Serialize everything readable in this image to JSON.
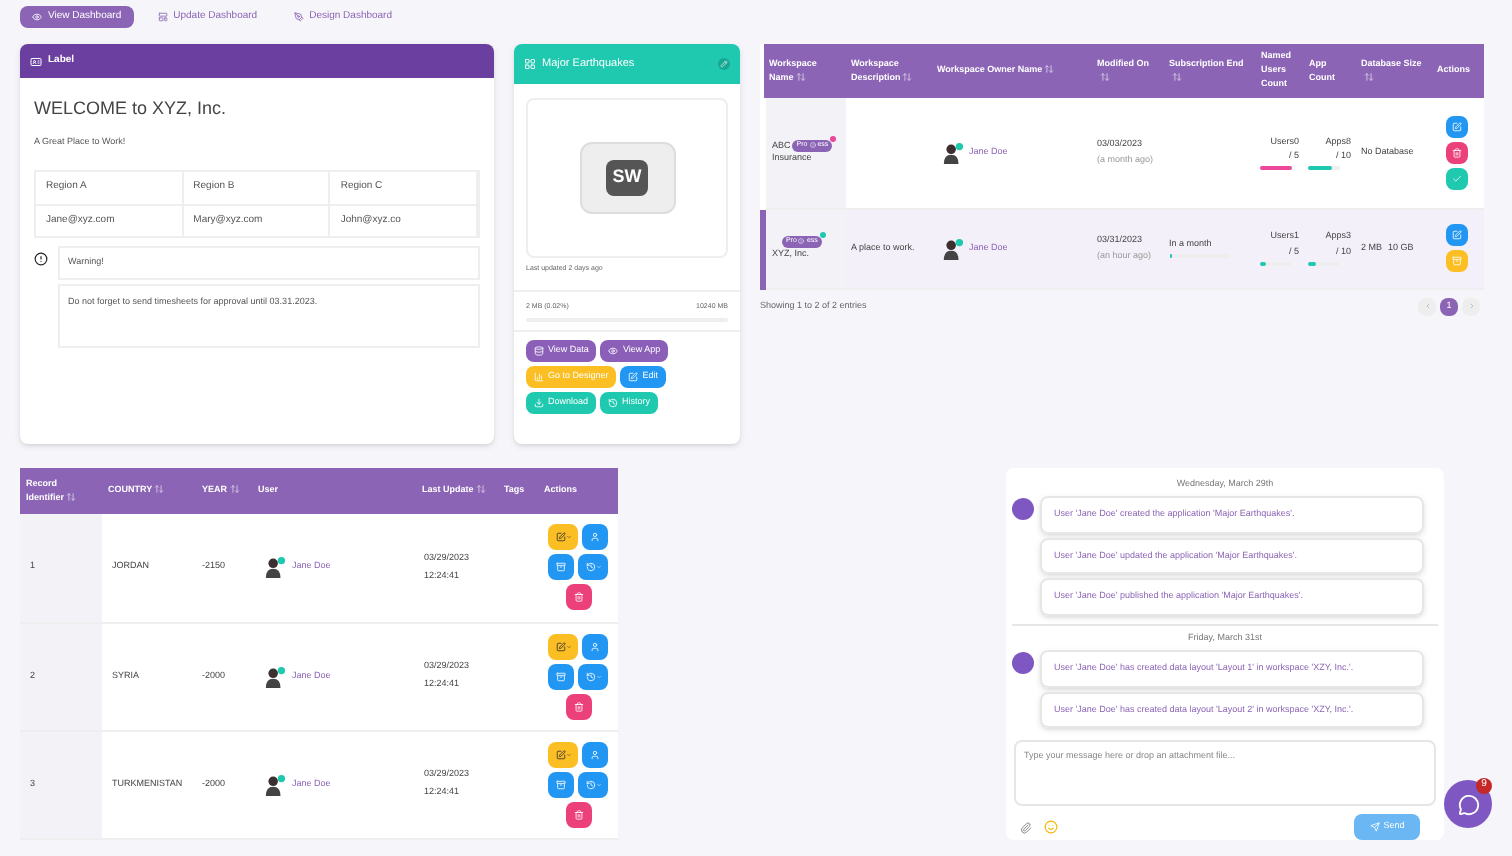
{
  "view_tabs": [
    {
      "label": "View Dashboard",
      "selected": true
    },
    {
      "label": "Update Dashboard",
      "selected": false
    },
    {
      "label": "Design Dashboard",
      "selected": false
    }
  ],
  "label_card": {
    "title": "Label",
    "heading": "WELCOME to XYZ, Inc.",
    "subheading": "A Great Place to Work!",
    "region_headers": [
      "Region A",
      "Region B",
      "Region C"
    ],
    "region_emails": [
      "Jane@xyz.com",
      "Mary@xyz.com",
      "John@xyz.co"
    ],
    "warning_title": "Warning!",
    "warning_message": "Do not forget to send timesheets for approval until 03.31.2023."
  },
  "app_card": {
    "title": "Major Earthquakes",
    "logo_text": "SW",
    "updated": "Last updated 2 days ago",
    "storage": {
      "used": "2 MB (0.02%)",
      "total": "10240 MB",
      "level": 0.0002
    },
    "buttons": [
      {
        "label": "View Data",
        "kind": "data",
        "color": "#8b5fb8"
      },
      {
        "label": "View App",
        "kind": "app",
        "color": "#8b5fb8"
      },
      {
        "label": "Go to Designer",
        "kind": "designer",
        "color": "#fbbf24"
      },
      {
        "label": "Edit",
        "kind": "edit",
        "color": "#2196f3"
      },
      {
        "label": "Download",
        "kind": "download",
        "color": "#1ec9b0"
      },
      {
        "label": "History",
        "kind": "history",
        "color": "#1ec9b0"
      }
    ]
  },
  "workspaces": {
    "columns": [
      {
        "label": "Workspace Name",
        "sortable": true
      },
      {
        "label": "Workspace Description",
        "sortable": true
      },
      {
        "label": "Workspace Owner Name",
        "sortable": true
      },
      {
        "label": "Modified On",
        "sortable": true
      },
      {
        "label": "Subscription End",
        "sortable": true
      },
      {
        "label": "Named Users Count",
        "sortable": false
      },
      {
        "label": "App Count",
        "sortable": false
      },
      {
        "label": "Database Size",
        "sortable": true
      },
      {
        "label": "Actions",
        "sortable": false
      }
    ],
    "rows": [
      {
        "selected": false,
        "name_start": "ABC",
        "name_end": "Insurance",
        "badge": {
          "label": "Pro",
          "suffix": "ess",
          "color": "#ec4899"
        },
        "owner": "Jane Doe",
        "modified": "03/03/2023",
        "modified_ago": "(a month ago)",
        "users": {
          "text": "Users0",
          "max": "/ 5",
          "level": 1,
          "color": "#ec4899"
        },
        "apps": {
          "text": "Apps8",
          "max": "/ 10",
          "level": 0.8,
          "color": "#1ec9b0"
        },
        "database": "No Database",
        "actions": [
          {
            "kind": "edit"
          },
          {
            "kind": "delete"
          },
          {
            "kind": "check"
          }
        ]
      },
      {
        "selected": true,
        "name_end": "XYZ, Inc.",
        "badge": {
          "label": "Pro",
          "suffix": "ess",
          "color": "#1ec9b0"
        },
        "description": "A place to work.",
        "owner": "Jane Doe",
        "modified": "03/31/2023",
        "modified_ago": "(an hour ago)",
        "subscription": {
          "text": "In a month",
          "level": 0.05
        },
        "users": {
          "text": "Users1",
          "max": "/ 5",
          "level": 0.2,
          "color": "#1ec9b0"
        },
        "apps": {
          "text": "Apps3",
          "max": "/ 10",
          "level": 0.3,
          "color": "#1ec9b0"
        },
        "database": "2 MB",
        "database_total": "10 GB",
        "actions": [
          {
            "kind": "edit"
          },
          {
            "kind": "archive"
          }
        ]
      }
    ],
    "entries": "Showing 1 to 2 of 2 entries",
    "pages": [
      {
        "label": "1",
        "selected": true
      }
    ]
  },
  "records": {
    "columns": [
      {
        "label": "Record Identifier",
        "sortable": true
      },
      {
        "label": "COUNTRY",
        "sortable": true
      },
      {
        "label": "YEAR",
        "sortable": true
      },
      {
        "label": "User",
        "sortable": false
      },
      {
        "label": "Last Update",
        "sortable": true
      },
      {
        "label": "Tags",
        "sortable": false
      },
      {
        "label": "Actions",
        "sortable": false
      }
    ],
    "rows": [
      {
        "id": "1",
        "country": "JORDAN",
        "year": "-2150",
        "user": "Jane Doe",
        "date": "03/29/2023",
        "time": "12:24:41"
      },
      {
        "id": "2",
        "country": "SYRIA",
        "year": "-2000",
        "user": "Jane Doe",
        "date": "03/29/2023",
        "time": "12:24:41"
      },
      {
        "id": "3",
        "country": "TURKMENISTAN",
        "year": "-2000",
        "user": "Jane Doe",
        "date": "03/29/2023",
        "time": "12:24:41"
      }
    ]
  },
  "activity": {
    "groups": [
      {
        "date": "Wednesday, March 29th",
        "messages": [
          "User 'Jane Doe' created the application 'Major Earthquakes'.",
          "User 'Jane Doe' updated the application 'Major Earthquakes'.",
          "User 'Jane Doe' published the application 'Major Earthquakes'."
        ]
      },
      {
        "date": "Friday, March 31st",
        "messages": [
          "User 'Jane Doe' has created data layout 'Layout 1' in workspace 'XZY, Inc.'.",
          "User 'Jane Doe' has created data layout 'Layout 2' in workspace 'XZY, Inc.'."
        ]
      }
    ],
    "placeholder": "Type your message here or drop an attachment file...",
    "send": "Send"
  },
  "chat_widget": {
    "badge": "9"
  }
}
